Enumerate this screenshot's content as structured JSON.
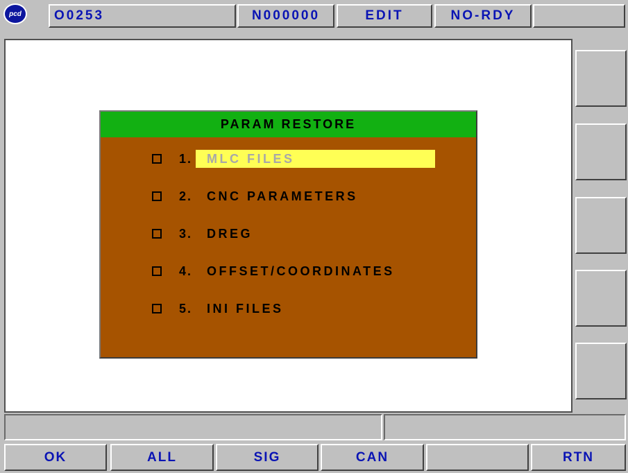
{
  "logo": {
    "text": "pcd"
  },
  "status_bar": {
    "program": "O0253",
    "sequence": "N000000",
    "mode": "EDIT",
    "status": "NO-RDY"
  },
  "dialog": {
    "title": "PARAM RESTORE",
    "selected_index": 0,
    "options": [
      {
        "number": "1.",
        "label": "MLC FILES"
      },
      {
        "number": "2.",
        "label": "CNC PARAMETERS"
      },
      {
        "number": "3.",
        "label": "DREG"
      },
      {
        "number": "4.",
        "label": "OFFSET/COORDINATES"
      },
      {
        "number": "5.",
        "label": "INI FILES"
      }
    ]
  },
  "function_keys": [
    {
      "label": "OK"
    },
    {
      "label": "ALL"
    },
    {
      "label": "SIG"
    },
    {
      "label": "CAN"
    },
    {
      "label": ""
    },
    {
      "label": "RTN"
    }
  ],
  "colors": {
    "text_blue": "#0a14b4",
    "dialog_body": "#a65300",
    "dialog_title": "#12b012",
    "selection": "#ffff55"
  }
}
